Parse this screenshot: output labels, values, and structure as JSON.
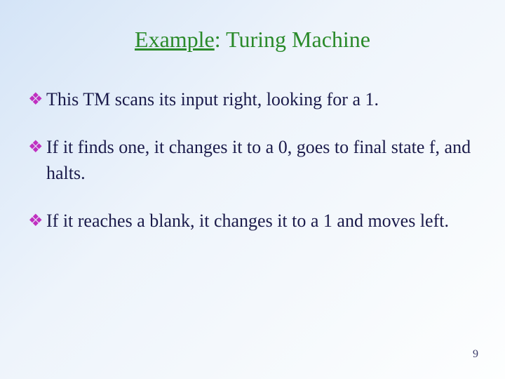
{
  "title": {
    "word_underlined": "Example",
    "rest": ": Turing Machine"
  },
  "bullets": [
    {
      "glyph": "❖",
      "text": "This TM scans its input right, looking for a 1."
    },
    {
      "glyph": "❖",
      "text": "If it finds one, it changes it to a 0, goes to final state f, and halts."
    },
    {
      "glyph": "❖",
      "text": "If it reaches a blank, it changes it to a 1 and moves left."
    }
  ],
  "page_number": "9"
}
